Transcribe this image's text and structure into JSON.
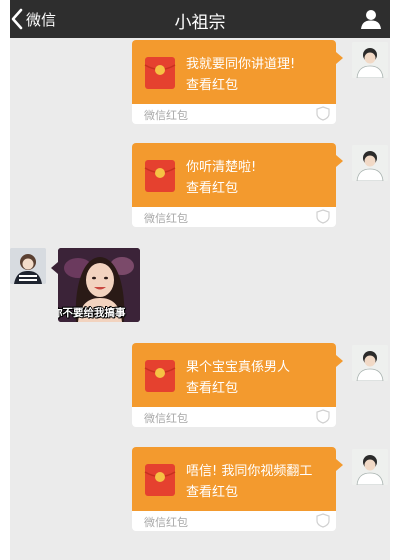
{
  "header": {
    "back_label": "微信",
    "title": "小祖宗"
  },
  "messages": [
    {
      "side": "right",
      "type": "red-packet",
      "greeting": "我就要同你讲道理!",
      "view_label": "查看红包",
      "footer_label": "微信红包"
    },
    {
      "side": "right",
      "type": "red-packet",
      "greeting": "你听清楚啦!",
      "view_label": "查看红包",
      "footer_label": "微信红包"
    },
    {
      "side": "left",
      "type": "sticker",
      "caption": "你不要给我搞事"
    },
    {
      "side": "right",
      "type": "red-packet",
      "greeting": "果个宝宝真係男人",
      "view_label": "查看红包",
      "footer_label": "微信红包"
    },
    {
      "side": "right",
      "type": "red-packet",
      "greeting": "唔信! 我同你视频翻工",
      "view_label": "查看红包",
      "footer_label": "微信红包"
    }
  ],
  "colors": {
    "topbar": "#2e2e2e",
    "chat_background": "#ebebeb",
    "red_packet": "#f39a2e",
    "envelope_red": "#e5412f",
    "envelope_gold": "#f6c244"
  },
  "icons": {
    "back": "chevron-left-icon",
    "profile": "person-icon",
    "envelope": "red-envelope-icon",
    "badge": "shield-icon"
  }
}
